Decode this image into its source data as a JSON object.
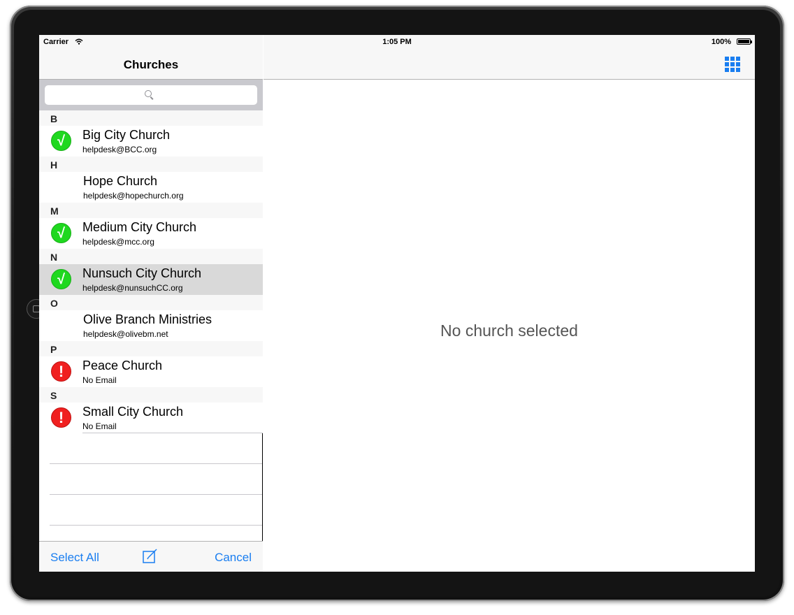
{
  "status_bar": {
    "carrier": "Carrier",
    "time": "1:05 PM",
    "battery": "100%"
  },
  "master": {
    "title": "Churches",
    "search": {
      "placeholder": ""
    },
    "sections": [
      {
        "letter": "B",
        "rows": [
          {
            "name": "Big City Church",
            "email": "helpdesk@BCC.org",
            "status": "ok",
            "selected": false
          }
        ]
      },
      {
        "letter": "H",
        "rows": [
          {
            "name": "Hope Church",
            "email": "helpdesk@hopechurch.org",
            "status": "none",
            "selected": false
          }
        ]
      },
      {
        "letter": "M",
        "rows": [
          {
            "name": "Medium City Church",
            "email": "helpdesk@mcc.org",
            "status": "ok",
            "selected": false
          }
        ]
      },
      {
        "letter": "N",
        "rows": [
          {
            "name": "Nunsuch City Church",
            "email": "helpdesk@nunsuchCC.org",
            "status": "ok",
            "selected": true
          }
        ]
      },
      {
        "letter": "O",
        "rows": [
          {
            "name": "Olive Branch Ministries",
            "email": "helpdesk@olivebm.net",
            "status": "none",
            "selected": false
          }
        ]
      },
      {
        "letter": "P",
        "rows": [
          {
            "name": "Peace Church",
            "email": "No Email",
            "status": "warn",
            "selected": false
          }
        ]
      },
      {
        "letter": "S",
        "rows": [
          {
            "name": "Small City Church",
            "email": "No Email",
            "status": "warn",
            "selected": false
          }
        ]
      }
    ],
    "toolbar": {
      "select_all": "Select All",
      "cancel": "Cancel",
      "compose_icon": "compose-icon"
    }
  },
  "detail": {
    "grid_icon": "grid-icon",
    "placeholder": "No church selected"
  },
  "colors": {
    "accent": "#1a7ef0",
    "ok": "#1fd81f",
    "warn": "#f02020"
  }
}
